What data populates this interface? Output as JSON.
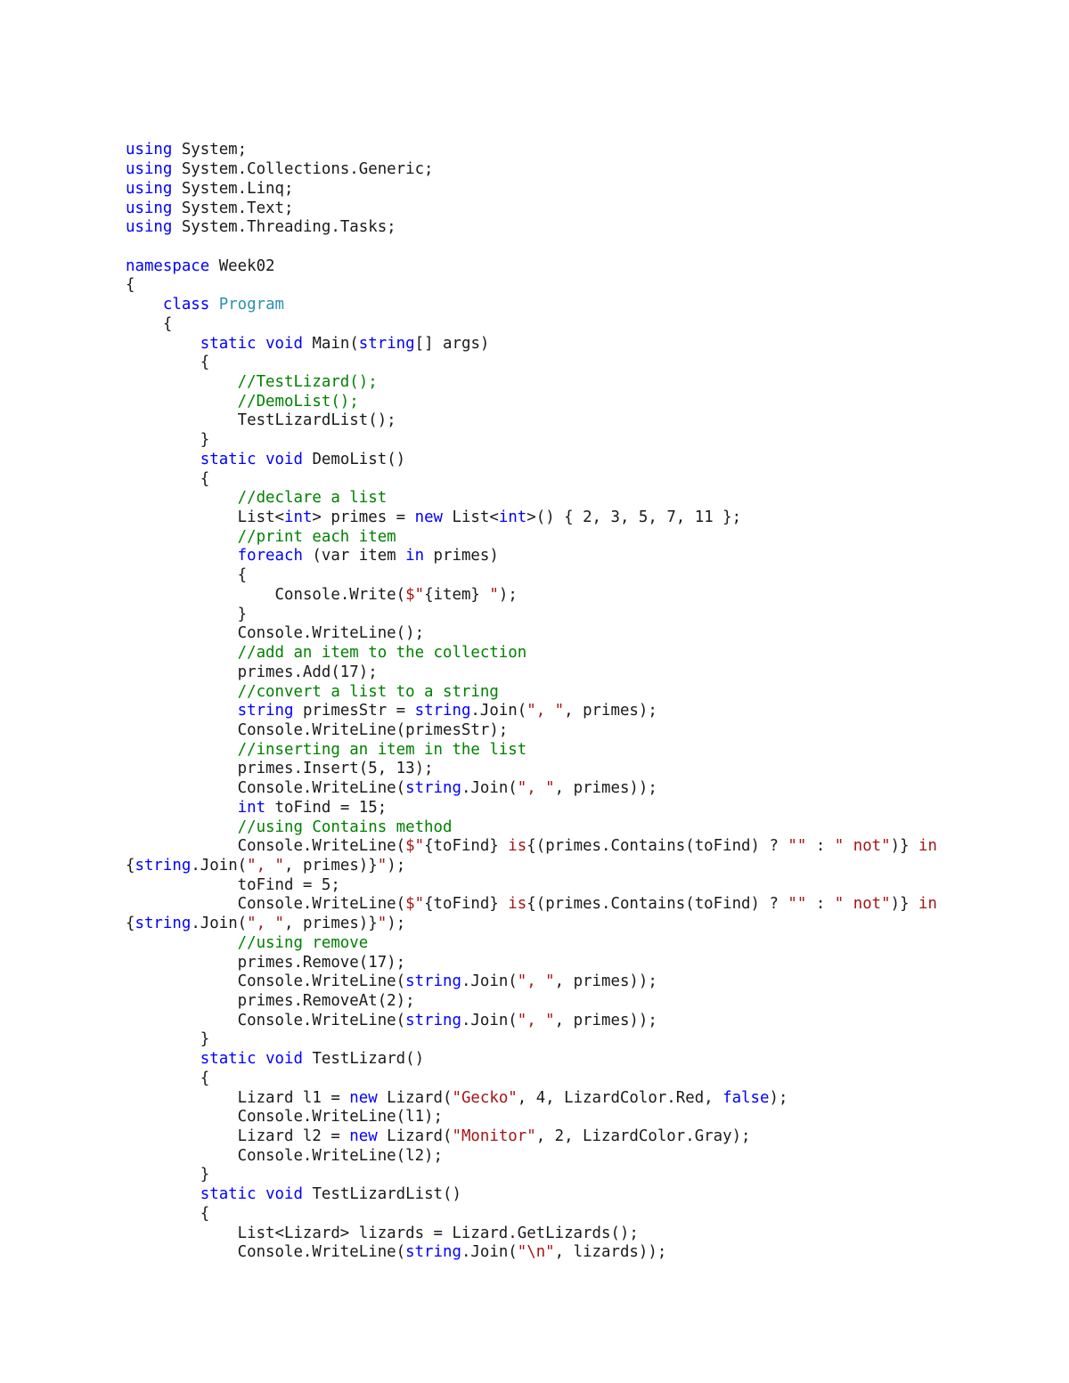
{
  "document": {
    "kind": "source-code-listing",
    "language": "C#",
    "page_background": "#ffffff",
    "text_color": "#1a1a1a"
  },
  "syntax_colors": {
    "keyword": "#0000FF",
    "type": "#2B91AF",
    "comment": "#008000",
    "string": "#A31515",
    "plain": "#1A1A1A"
  },
  "code": {
    "lines": [
      {
        "id": 1,
        "tokens": [
          {
            "t": "using",
            "c": "keyword"
          },
          {
            "t": " System;",
            "c": "plain"
          }
        ]
      },
      {
        "id": 2,
        "tokens": [
          {
            "t": "using",
            "c": "keyword"
          },
          {
            "t": " System.Collections.Generic;",
            "c": "plain"
          }
        ]
      },
      {
        "id": 3,
        "tokens": [
          {
            "t": "using",
            "c": "keyword"
          },
          {
            "t": " System.Linq;",
            "c": "plain"
          }
        ]
      },
      {
        "id": 4,
        "tokens": [
          {
            "t": "using",
            "c": "keyword"
          },
          {
            "t": " System.Text;",
            "c": "plain"
          }
        ]
      },
      {
        "id": 5,
        "tokens": [
          {
            "t": "using",
            "c": "keyword"
          },
          {
            "t": " System.Threading.Tasks;",
            "c": "plain"
          }
        ]
      },
      {
        "id": 6,
        "tokens": []
      },
      {
        "id": 7,
        "tokens": [
          {
            "t": "namespace",
            "c": "keyword"
          },
          {
            "t": " Week02",
            "c": "plain"
          }
        ]
      },
      {
        "id": 8,
        "tokens": [
          {
            "t": "{",
            "c": "plain"
          }
        ]
      },
      {
        "id": 9,
        "tokens": [
          {
            "t": "    ",
            "c": "plain"
          },
          {
            "t": "class",
            "c": "keyword"
          },
          {
            "t": " ",
            "c": "plain"
          },
          {
            "t": "Program",
            "c": "type"
          }
        ]
      },
      {
        "id": 10,
        "tokens": [
          {
            "t": "    {",
            "c": "plain"
          }
        ]
      },
      {
        "id": 11,
        "tokens": [
          {
            "t": "        ",
            "c": "plain"
          },
          {
            "t": "static",
            "c": "keyword"
          },
          {
            "t": " ",
            "c": "plain"
          },
          {
            "t": "void",
            "c": "keyword"
          },
          {
            "t": " Main(",
            "c": "plain"
          },
          {
            "t": "string",
            "c": "keyword"
          },
          {
            "t": "[] args)",
            "c": "plain"
          }
        ]
      },
      {
        "id": 12,
        "tokens": [
          {
            "t": "        {",
            "c": "plain"
          }
        ]
      },
      {
        "id": 13,
        "tokens": [
          {
            "t": "            ",
            "c": "plain"
          },
          {
            "t": "//TestLizard();",
            "c": "comment"
          }
        ]
      },
      {
        "id": 14,
        "tokens": [
          {
            "t": "            ",
            "c": "plain"
          },
          {
            "t": "//DemoList();",
            "c": "comment"
          }
        ]
      },
      {
        "id": 15,
        "tokens": [
          {
            "t": "            TestLizardList();",
            "c": "plain"
          }
        ]
      },
      {
        "id": 16,
        "tokens": [
          {
            "t": "        }",
            "c": "plain"
          }
        ]
      },
      {
        "id": 17,
        "tokens": [
          {
            "t": "        ",
            "c": "plain"
          },
          {
            "t": "static",
            "c": "keyword"
          },
          {
            "t": " ",
            "c": "plain"
          },
          {
            "t": "void",
            "c": "keyword"
          },
          {
            "t": " DemoList()",
            "c": "plain"
          }
        ]
      },
      {
        "id": 18,
        "tokens": [
          {
            "t": "        {",
            "c": "plain"
          }
        ]
      },
      {
        "id": 19,
        "tokens": [
          {
            "t": "            ",
            "c": "plain"
          },
          {
            "t": "//declare a list",
            "c": "comment"
          }
        ]
      },
      {
        "id": 20,
        "tokens": [
          {
            "t": "            List<",
            "c": "plain"
          },
          {
            "t": "int",
            "c": "keyword"
          },
          {
            "t": "> primes = ",
            "c": "plain"
          },
          {
            "t": "new",
            "c": "keyword"
          },
          {
            "t": " List<",
            "c": "plain"
          },
          {
            "t": "int",
            "c": "keyword"
          },
          {
            "t": ">() { 2, 3, 5, 7, 11 };",
            "c": "plain"
          }
        ]
      },
      {
        "id": 21,
        "tokens": [
          {
            "t": "            ",
            "c": "plain"
          },
          {
            "t": "//print each item",
            "c": "comment"
          }
        ]
      },
      {
        "id": 22,
        "tokens": [
          {
            "t": "            ",
            "c": "plain"
          },
          {
            "t": "foreach",
            "c": "keyword"
          },
          {
            "t": " (var item ",
            "c": "plain"
          },
          {
            "t": "in",
            "c": "keyword"
          },
          {
            "t": " primes)",
            "c": "plain"
          }
        ]
      },
      {
        "id": 23,
        "tokens": [
          {
            "t": "            {",
            "c": "plain"
          }
        ]
      },
      {
        "id": 24,
        "tokens": [
          {
            "t": "                Console.Write(",
            "c": "plain"
          },
          {
            "t": "$\"",
            "c": "string"
          },
          {
            "t": "{item} ",
            "c": "plain"
          },
          {
            "t": "\"",
            "c": "string"
          },
          {
            "t": ");",
            "c": "plain"
          }
        ]
      },
      {
        "id": 25,
        "tokens": [
          {
            "t": "            }",
            "c": "plain"
          }
        ]
      },
      {
        "id": 26,
        "tokens": [
          {
            "t": "            Console.WriteLine();",
            "c": "plain"
          }
        ]
      },
      {
        "id": 27,
        "tokens": [
          {
            "t": "            ",
            "c": "plain"
          },
          {
            "t": "//add an item to the collection",
            "c": "comment"
          }
        ]
      },
      {
        "id": 28,
        "tokens": [
          {
            "t": "            primes.Add(17);",
            "c": "plain"
          }
        ]
      },
      {
        "id": 29,
        "tokens": [
          {
            "t": "            ",
            "c": "plain"
          },
          {
            "t": "//convert a list to a string",
            "c": "comment"
          }
        ]
      },
      {
        "id": 30,
        "tokens": [
          {
            "t": "            ",
            "c": "plain"
          },
          {
            "t": "string",
            "c": "keyword"
          },
          {
            "t": " primesStr = ",
            "c": "plain"
          },
          {
            "t": "string",
            "c": "keyword"
          },
          {
            "t": ".Join(",
            "c": "plain"
          },
          {
            "t": "\", \"",
            "c": "string"
          },
          {
            "t": ", primes);",
            "c": "plain"
          }
        ]
      },
      {
        "id": 31,
        "tokens": [
          {
            "t": "            Console.WriteLine(primesStr);",
            "c": "plain"
          }
        ]
      },
      {
        "id": 32,
        "tokens": [
          {
            "t": "            ",
            "c": "plain"
          },
          {
            "t": "//inserting an item in the list",
            "c": "comment"
          }
        ]
      },
      {
        "id": 33,
        "tokens": [
          {
            "t": "            primes.Insert(5, 13);",
            "c": "plain"
          }
        ]
      },
      {
        "id": 34,
        "tokens": [
          {
            "t": "            Console.WriteLine(",
            "c": "plain"
          },
          {
            "t": "string",
            "c": "keyword"
          },
          {
            "t": ".Join(",
            "c": "plain"
          },
          {
            "t": "\", \"",
            "c": "string"
          },
          {
            "t": ", primes));",
            "c": "plain"
          }
        ]
      },
      {
        "id": 35,
        "tokens": [
          {
            "t": "            ",
            "c": "plain"
          },
          {
            "t": "int",
            "c": "keyword"
          },
          {
            "t": " toFind = 15;",
            "c": "plain"
          }
        ]
      },
      {
        "id": 36,
        "tokens": [
          {
            "t": "            ",
            "c": "plain"
          },
          {
            "t": "//using Contains method",
            "c": "comment"
          }
        ]
      },
      {
        "id": 37,
        "tokens": [
          {
            "t": "            Console.WriteLine(",
            "c": "plain"
          },
          {
            "t": "$\"",
            "c": "string"
          },
          {
            "t": "{toFind}",
            "c": "plain"
          },
          {
            "t": " is",
            "c": "string"
          },
          {
            "t": "{(primes.Contains(toFind) ? ",
            "c": "plain"
          },
          {
            "t": "\"\"",
            "c": "string"
          },
          {
            "t": " : ",
            "c": "plain"
          },
          {
            "t": "\" not\"",
            "c": "string"
          },
          {
            "t": ")}",
            "c": "plain"
          },
          {
            "t": " in ",
            "c": "string"
          },
          {
            "t": "{",
            "c": "plain"
          },
          {
            "t": "string",
            "c": "keyword"
          },
          {
            "t": ".Join(",
            "c": "plain"
          },
          {
            "t": "\", \"",
            "c": "string"
          },
          {
            "t": ", primes)}",
            "c": "plain"
          },
          {
            "t": "\"",
            "c": "string"
          },
          {
            "t": ");",
            "c": "plain"
          }
        ]
      },
      {
        "id": 38,
        "tokens": [
          {
            "t": "            toFind = 5;",
            "c": "plain"
          }
        ]
      },
      {
        "id": 39,
        "tokens": [
          {
            "t": "            Console.WriteLine(",
            "c": "plain"
          },
          {
            "t": "$\"",
            "c": "string"
          },
          {
            "t": "{toFind}",
            "c": "plain"
          },
          {
            "t": " is",
            "c": "string"
          },
          {
            "t": "{(primes.Contains(toFind) ? ",
            "c": "plain"
          },
          {
            "t": "\"\"",
            "c": "string"
          },
          {
            "t": " : ",
            "c": "plain"
          },
          {
            "t": "\" not\"",
            "c": "string"
          },
          {
            "t": ")}",
            "c": "plain"
          },
          {
            "t": " in ",
            "c": "string"
          },
          {
            "t": "{",
            "c": "plain"
          },
          {
            "t": "string",
            "c": "keyword"
          },
          {
            "t": ".Join(",
            "c": "plain"
          },
          {
            "t": "\", \"",
            "c": "string"
          },
          {
            "t": ", primes)}",
            "c": "plain"
          },
          {
            "t": "\"",
            "c": "string"
          },
          {
            "t": ");",
            "c": "plain"
          }
        ]
      },
      {
        "id": 40,
        "tokens": [
          {
            "t": "            ",
            "c": "plain"
          },
          {
            "t": "//using remove",
            "c": "comment"
          }
        ]
      },
      {
        "id": 41,
        "tokens": [
          {
            "t": "            primes.Remove(17);",
            "c": "plain"
          }
        ]
      },
      {
        "id": 42,
        "tokens": [
          {
            "t": "            Console.WriteLine(",
            "c": "plain"
          },
          {
            "t": "string",
            "c": "keyword"
          },
          {
            "t": ".Join(",
            "c": "plain"
          },
          {
            "t": "\", \"",
            "c": "string"
          },
          {
            "t": ", primes));",
            "c": "plain"
          }
        ]
      },
      {
        "id": 43,
        "tokens": [
          {
            "t": "            primes.RemoveAt(2);",
            "c": "plain"
          }
        ]
      },
      {
        "id": 44,
        "tokens": [
          {
            "t": "            Console.WriteLine(",
            "c": "plain"
          },
          {
            "t": "string",
            "c": "keyword"
          },
          {
            "t": ".Join(",
            "c": "plain"
          },
          {
            "t": "\", \"",
            "c": "string"
          },
          {
            "t": ", primes));",
            "c": "plain"
          }
        ]
      },
      {
        "id": 45,
        "tokens": [
          {
            "t": "        }",
            "c": "plain"
          }
        ]
      },
      {
        "id": 46,
        "tokens": [
          {
            "t": "        ",
            "c": "plain"
          },
          {
            "t": "static",
            "c": "keyword"
          },
          {
            "t": " ",
            "c": "plain"
          },
          {
            "t": "void",
            "c": "keyword"
          },
          {
            "t": " TestLizard()",
            "c": "plain"
          }
        ]
      },
      {
        "id": 47,
        "tokens": [
          {
            "t": "        {",
            "c": "plain"
          }
        ]
      },
      {
        "id": 48,
        "tokens": [
          {
            "t": "            Lizard l1 = ",
            "c": "plain"
          },
          {
            "t": "new",
            "c": "keyword"
          },
          {
            "t": " Lizard(",
            "c": "plain"
          },
          {
            "t": "\"Gecko\"",
            "c": "string"
          },
          {
            "t": ", 4, LizardColor.Red, ",
            "c": "plain"
          },
          {
            "t": "false",
            "c": "keyword"
          },
          {
            "t": ");",
            "c": "plain"
          }
        ]
      },
      {
        "id": 49,
        "tokens": [
          {
            "t": "            Console.WriteLine(l1);",
            "c": "plain"
          }
        ]
      },
      {
        "id": 50,
        "tokens": [
          {
            "t": "            Lizard l2 = ",
            "c": "plain"
          },
          {
            "t": "new",
            "c": "keyword"
          },
          {
            "t": " Lizard(",
            "c": "plain"
          },
          {
            "t": "\"Monitor\"",
            "c": "string"
          },
          {
            "t": ", 2, LizardColor.Gray);",
            "c": "plain"
          }
        ]
      },
      {
        "id": 51,
        "tokens": [
          {
            "t": "            Console.WriteLine(l2);",
            "c": "plain"
          }
        ]
      },
      {
        "id": 52,
        "tokens": [
          {
            "t": "        }",
            "c": "plain"
          }
        ]
      },
      {
        "id": 53,
        "tokens": [
          {
            "t": "        ",
            "c": "plain"
          },
          {
            "t": "static",
            "c": "keyword"
          },
          {
            "t": " ",
            "c": "plain"
          },
          {
            "t": "void",
            "c": "keyword"
          },
          {
            "t": " TestLizardList()",
            "c": "plain"
          }
        ]
      },
      {
        "id": 54,
        "tokens": [
          {
            "t": "        {",
            "c": "plain"
          }
        ]
      },
      {
        "id": 55,
        "tokens": [
          {
            "t": "            List<Lizard> lizards = Lizard.GetLizards();",
            "c": "plain"
          }
        ]
      },
      {
        "id": 56,
        "tokens": [
          {
            "t": "            Console.WriteLine(",
            "c": "plain"
          },
          {
            "t": "string",
            "c": "keyword"
          },
          {
            "t": ".Join(",
            "c": "plain"
          },
          {
            "t": "\"\\n\"",
            "c": "string"
          },
          {
            "t": ", lizards));",
            "c": "plain"
          }
        ]
      }
    ]
  }
}
